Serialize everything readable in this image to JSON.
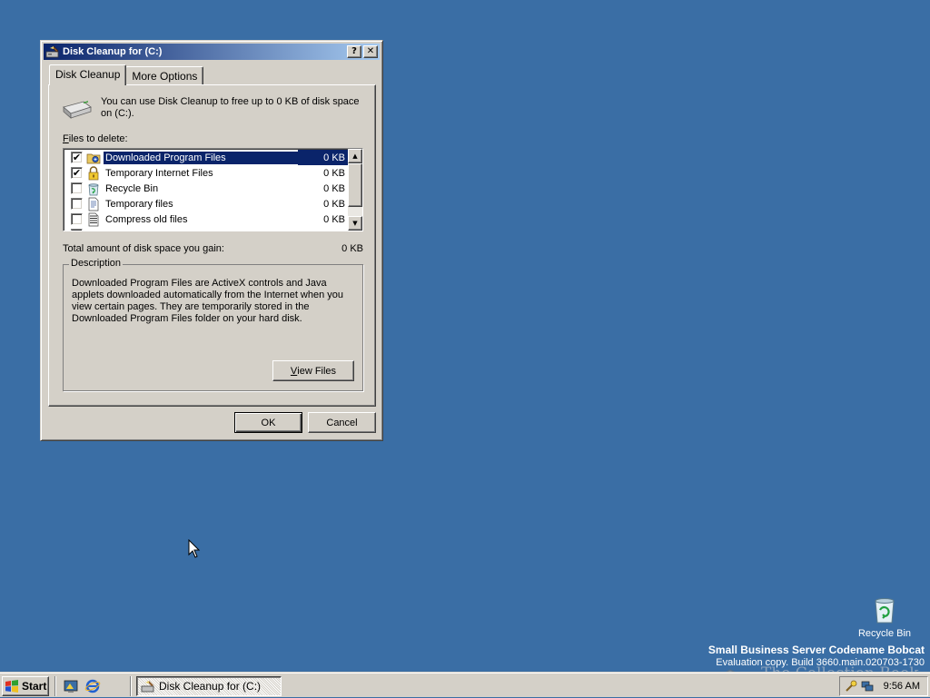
{
  "window": {
    "title": "Disk Cleanup for  (C:)",
    "help_glyph": "?",
    "close_glyph": "✕"
  },
  "tabs": [
    {
      "label": "Disk Cleanup",
      "active": true
    },
    {
      "label": "More Options",
      "active": false
    }
  ],
  "intro": "You can use Disk Cleanup to free up to 0 KB of disk space on  (C:).",
  "files_label": {
    "mnemonic": "F",
    "rest": "iles to delete:"
  },
  "files": [
    {
      "label": "Downloaded Program Files",
      "size": "0 KB",
      "checked": true,
      "selected": true,
      "icon": "folder-download-icon"
    },
    {
      "label": "Temporary Internet Files",
      "size": "0 KB",
      "checked": true,
      "selected": false,
      "icon": "lock-icon"
    },
    {
      "label": "Recycle Bin",
      "size": "0 KB",
      "checked": false,
      "selected": false,
      "icon": "recycle-bin-icon"
    },
    {
      "label": "Temporary files",
      "size": "0 KB",
      "checked": false,
      "selected": false,
      "icon": "document-icon"
    },
    {
      "label": "Compress old files",
      "size": "0 KB",
      "checked": false,
      "selected": false,
      "icon": "compress-icon"
    }
  ],
  "check_glyph": "✔",
  "total": {
    "label": "Total amount of disk space you gain:",
    "value": "0 KB"
  },
  "description": {
    "title": "Description",
    "text": "Downloaded Program Files are ActiveX controls and Java applets downloaded automatically from the Internet when you view certain pages. They are temporarily stored in the Downloaded Program Files folder on your hard disk.",
    "view_files": {
      "mnemonic": "V",
      "rest": "iew Files"
    }
  },
  "buttons": {
    "ok": "OK",
    "cancel": "Cancel"
  },
  "desktop": {
    "recycle_bin": "Recycle Bin",
    "watermark_line1": "Small Business Server Codename Bobcat",
    "watermark_line2": "Evaluation copy. Build 3660.main.020703-1730",
    "site_mark": "The Collection Book"
  },
  "taskbar": {
    "start": "Start",
    "task_button": "Disk Cleanup for  (C:)",
    "clock": "9:56 AM"
  },
  "colors": {
    "desktop": "#3a6ea5",
    "title_active": "#0a246a",
    "selection": "#0a246a",
    "face": "#d4d0c8"
  }
}
